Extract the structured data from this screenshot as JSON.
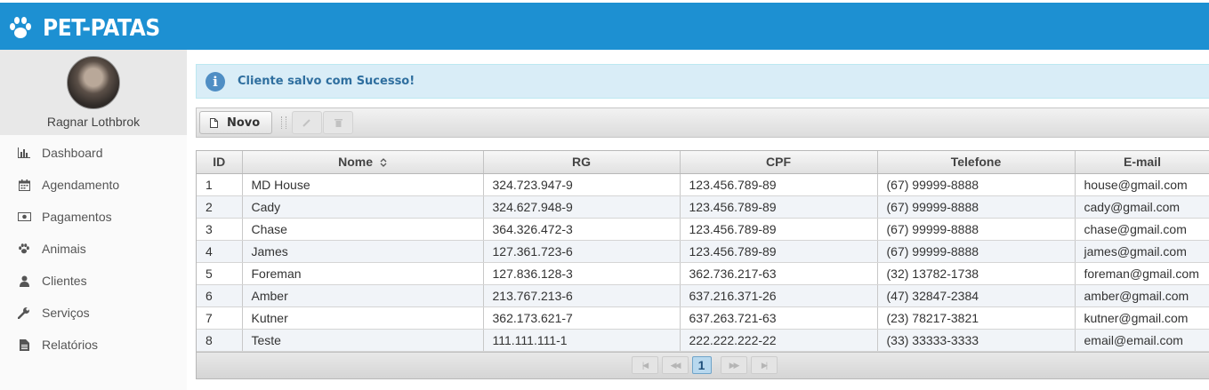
{
  "app": {
    "brand": "PET-PATAS"
  },
  "profile": {
    "name": "Ragnar Lothbrok"
  },
  "sidebar": {
    "items": [
      {
        "label": "Dashboard",
        "icon": "bar-chart-icon"
      },
      {
        "label": "Agendamento",
        "icon": "calendar-icon"
      },
      {
        "label": "Pagamentos",
        "icon": "money-icon"
      },
      {
        "label": "Animais",
        "icon": "paw-icon"
      },
      {
        "label": "Clientes",
        "icon": "user-icon"
      },
      {
        "label": "Serviços",
        "icon": "wrench-icon"
      },
      {
        "label": "Relatórios",
        "icon": "file-icon"
      }
    ]
  },
  "alert": {
    "message": "Cliente salvo com Sucesso!"
  },
  "toolbar": {
    "new_label": "Novo"
  },
  "table": {
    "columns": [
      "ID",
      "Nome",
      "RG",
      "CPF",
      "Telefone",
      "E-mail"
    ],
    "rows": [
      [
        "1",
        "MD House",
        "324.723.947-9",
        "123.456.789-89",
        "(67) 99999-8888",
        "house@gmail.com"
      ],
      [
        "2",
        "Cady",
        "324.627.948-9",
        "123.456.789-89",
        "(67) 99999-8888",
        "cady@gmail.com"
      ],
      [
        "3",
        "Chase",
        "364.326.472-3",
        "123.456.789-89",
        "(67) 99999-8888",
        "chase@gmail.com"
      ],
      [
        "4",
        "James",
        "127.361.723-6",
        "123.456.789-89",
        "(67) 99999-8888",
        "james@gmail.com"
      ],
      [
        "5",
        "Foreman",
        "127.836.128-3",
        "362.736.217-63",
        "(32) 13782-1738",
        "foreman@gmail.com"
      ],
      [
        "6",
        "Amber",
        "213.767.213-6",
        "637.216.371-26",
        "(47) 32847-2384",
        "amber@gmail.com"
      ],
      [
        "7",
        "Kutner",
        "362.173.621-7",
        "637.263.721-63",
        "(23) 78217-3821",
        "kutner@gmail.com"
      ],
      [
        "8",
        "Teste",
        "111.111.111-1",
        "222.222.222-22",
        "(33) 33333-3333",
        "email@email.com"
      ]
    ]
  },
  "pager": {
    "current_page": "1"
  },
  "colors": {
    "header_blue": "#1d90d2",
    "alert_bg": "#d9edf7",
    "alert_text": "#2f6f9f"
  }
}
